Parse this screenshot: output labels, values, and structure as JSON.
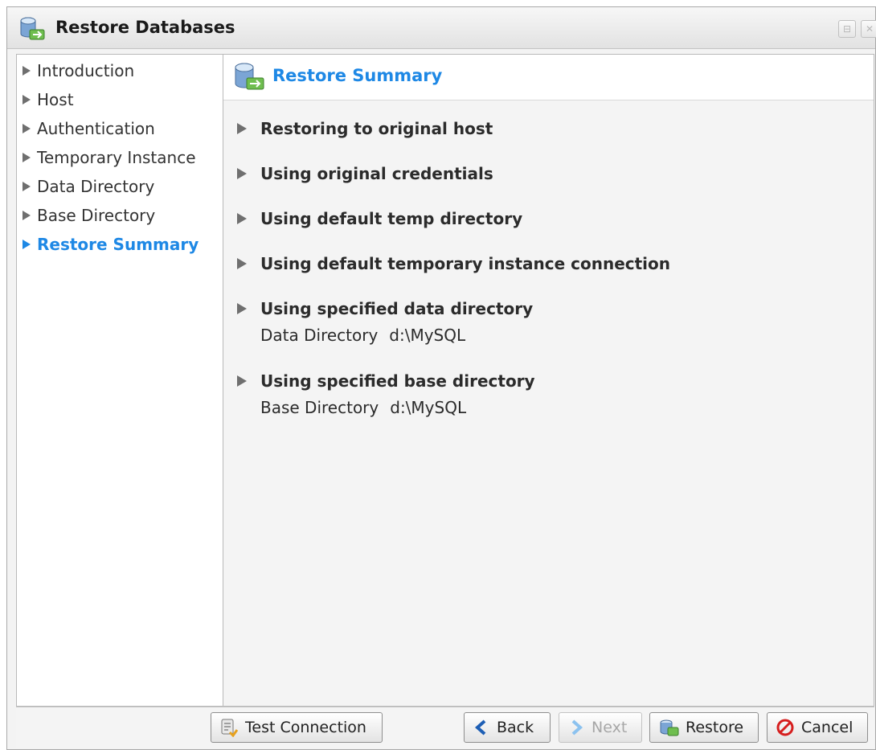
{
  "window": {
    "title": "Restore Databases"
  },
  "sidebar": {
    "items": [
      {
        "label": "Introduction",
        "active": false
      },
      {
        "label": "Host",
        "active": false
      },
      {
        "label": "Authentication",
        "active": false
      },
      {
        "label": "Temporary Instance",
        "active": false
      },
      {
        "label": "Data Directory",
        "active": false
      },
      {
        "label": "Base Directory",
        "active": false
      },
      {
        "label": "Restore Summary",
        "active": true
      }
    ]
  },
  "content": {
    "header": "Restore Summary",
    "sections": [
      {
        "title": "Restoring to original host"
      },
      {
        "title": "Using original credentials"
      },
      {
        "title": "Using default temp directory"
      },
      {
        "title": "Using default temporary instance connection"
      },
      {
        "title": "Using specified data directory",
        "detail_label": "Data Directory",
        "detail_value": "d:\\MySQL"
      },
      {
        "title": "Using specified base directory",
        "detail_label": "Base Directory",
        "detail_value": "d:\\MySQL"
      }
    ]
  },
  "buttons": {
    "test_connection": "Test Connection",
    "back": "Back",
    "next": "Next",
    "restore": "Restore",
    "cancel": "Cancel"
  },
  "icons": {
    "title": "database-restore-icon",
    "arrow": "triangle-right-icon",
    "test": "test-connection-icon",
    "back": "chevron-left-icon",
    "next": "chevron-right-icon",
    "restore": "restore-icon",
    "cancel": "cancel-icon"
  },
  "colors": {
    "accent": "#1e88e5",
    "text": "#2b2b2b",
    "disabled": "#a7a7a7"
  }
}
